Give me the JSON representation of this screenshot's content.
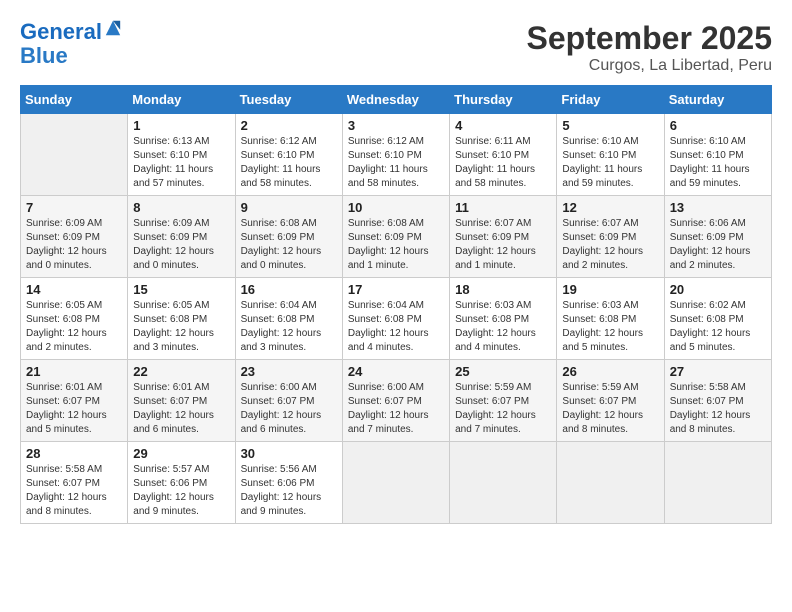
{
  "logo": {
    "line1": "General",
    "line2": "Blue"
  },
  "title": "September 2025",
  "subtitle": "Curgos, La Libertad, Peru",
  "days_of_week": [
    "Sunday",
    "Monday",
    "Tuesday",
    "Wednesday",
    "Thursday",
    "Friday",
    "Saturday"
  ],
  "weeks": [
    [
      {
        "day": "",
        "info": ""
      },
      {
        "day": "1",
        "info": "Sunrise: 6:13 AM\nSunset: 6:10 PM\nDaylight: 11 hours\nand 57 minutes."
      },
      {
        "day": "2",
        "info": "Sunrise: 6:12 AM\nSunset: 6:10 PM\nDaylight: 11 hours\nand 58 minutes."
      },
      {
        "day": "3",
        "info": "Sunrise: 6:12 AM\nSunset: 6:10 PM\nDaylight: 11 hours\nand 58 minutes."
      },
      {
        "day": "4",
        "info": "Sunrise: 6:11 AM\nSunset: 6:10 PM\nDaylight: 11 hours\nand 58 minutes."
      },
      {
        "day": "5",
        "info": "Sunrise: 6:10 AM\nSunset: 6:10 PM\nDaylight: 11 hours\nand 59 minutes."
      },
      {
        "day": "6",
        "info": "Sunrise: 6:10 AM\nSunset: 6:10 PM\nDaylight: 11 hours\nand 59 minutes."
      }
    ],
    [
      {
        "day": "7",
        "info": "Sunrise: 6:09 AM\nSunset: 6:09 PM\nDaylight: 12 hours\nand 0 minutes."
      },
      {
        "day": "8",
        "info": "Sunrise: 6:09 AM\nSunset: 6:09 PM\nDaylight: 12 hours\nand 0 minutes."
      },
      {
        "day": "9",
        "info": "Sunrise: 6:08 AM\nSunset: 6:09 PM\nDaylight: 12 hours\nand 0 minutes."
      },
      {
        "day": "10",
        "info": "Sunrise: 6:08 AM\nSunset: 6:09 PM\nDaylight: 12 hours\nand 1 minute."
      },
      {
        "day": "11",
        "info": "Sunrise: 6:07 AM\nSunset: 6:09 PM\nDaylight: 12 hours\nand 1 minute."
      },
      {
        "day": "12",
        "info": "Sunrise: 6:07 AM\nSunset: 6:09 PM\nDaylight: 12 hours\nand 2 minutes."
      },
      {
        "day": "13",
        "info": "Sunrise: 6:06 AM\nSunset: 6:09 PM\nDaylight: 12 hours\nand 2 minutes."
      }
    ],
    [
      {
        "day": "14",
        "info": "Sunrise: 6:05 AM\nSunset: 6:08 PM\nDaylight: 12 hours\nand 2 minutes."
      },
      {
        "day": "15",
        "info": "Sunrise: 6:05 AM\nSunset: 6:08 PM\nDaylight: 12 hours\nand 3 minutes."
      },
      {
        "day": "16",
        "info": "Sunrise: 6:04 AM\nSunset: 6:08 PM\nDaylight: 12 hours\nand 3 minutes."
      },
      {
        "day": "17",
        "info": "Sunrise: 6:04 AM\nSunset: 6:08 PM\nDaylight: 12 hours\nand 4 minutes."
      },
      {
        "day": "18",
        "info": "Sunrise: 6:03 AM\nSunset: 6:08 PM\nDaylight: 12 hours\nand 4 minutes."
      },
      {
        "day": "19",
        "info": "Sunrise: 6:03 AM\nSunset: 6:08 PM\nDaylight: 12 hours\nand 5 minutes."
      },
      {
        "day": "20",
        "info": "Sunrise: 6:02 AM\nSunset: 6:08 PM\nDaylight: 12 hours\nand 5 minutes."
      }
    ],
    [
      {
        "day": "21",
        "info": "Sunrise: 6:01 AM\nSunset: 6:07 PM\nDaylight: 12 hours\nand 5 minutes."
      },
      {
        "day": "22",
        "info": "Sunrise: 6:01 AM\nSunset: 6:07 PM\nDaylight: 12 hours\nand 6 minutes."
      },
      {
        "day": "23",
        "info": "Sunrise: 6:00 AM\nSunset: 6:07 PM\nDaylight: 12 hours\nand 6 minutes."
      },
      {
        "day": "24",
        "info": "Sunrise: 6:00 AM\nSunset: 6:07 PM\nDaylight: 12 hours\nand 7 minutes."
      },
      {
        "day": "25",
        "info": "Sunrise: 5:59 AM\nSunset: 6:07 PM\nDaylight: 12 hours\nand 7 minutes."
      },
      {
        "day": "26",
        "info": "Sunrise: 5:59 AM\nSunset: 6:07 PM\nDaylight: 12 hours\nand 8 minutes."
      },
      {
        "day": "27",
        "info": "Sunrise: 5:58 AM\nSunset: 6:07 PM\nDaylight: 12 hours\nand 8 minutes."
      }
    ],
    [
      {
        "day": "28",
        "info": "Sunrise: 5:58 AM\nSunset: 6:07 PM\nDaylight: 12 hours\nand 8 minutes."
      },
      {
        "day": "29",
        "info": "Sunrise: 5:57 AM\nSunset: 6:06 PM\nDaylight: 12 hours\nand 9 minutes."
      },
      {
        "day": "30",
        "info": "Sunrise: 5:56 AM\nSunset: 6:06 PM\nDaylight: 12 hours\nand 9 minutes."
      },
      {
        "day": "",
        "info": ""
      },
      {
        "day": "",
        "info": ""
      },
      {
        "day": "",
        "info": ""
      },
      {
        "day": "",
        "info": ""
      }
    ]
  ]
}
